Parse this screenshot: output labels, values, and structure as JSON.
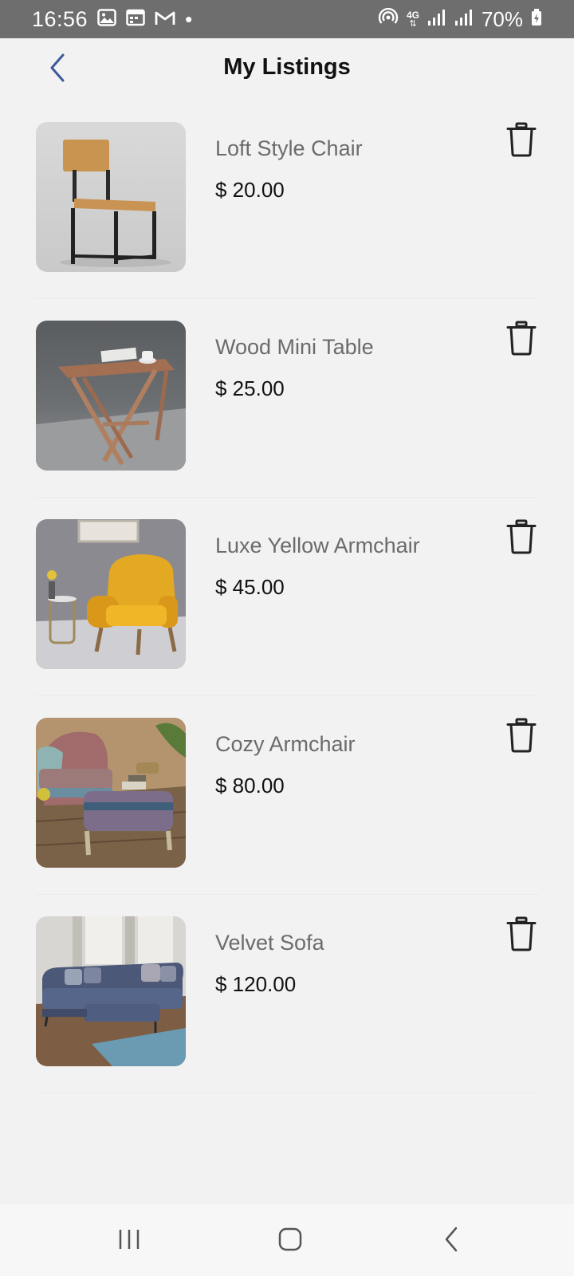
{
  "status_bar": {
    "time": "16:56",
    "battery": "70%",
    "network": "4G",
    "notification_dot": "•"
  },
  "header": {
    "title": "My Listings"
  },
  "listings": [
    {
      "name": "Loft Style Chair",
      "price": "$ 20.00"
    },
    {
      "name": "Wood Mini Table",
      "price": "$ 25.00"
    },
    {
      "name": "Luxe Yellow Armchair",
      "price": "$ 45.00"
    },
    {
      "name": "Cozy Armchair",
      "price": "$ 80.00"
    },
    {
      "name": "Velvet Sofa",
      "price": "$ 120.00"
    }
  ],
  "icons": {
    "back": "chevron-left-icon",
    "delete": "trash-icon",
    "nav_recents": "recent-apps-icon",
    "nav_home": "home-icon",
    "nav_back": "back-icon"
  },
  "colors": {
    "accent": "#3d5a99",
    "background": "#f2f2f2",
    "status_bar": "#6e6e6e",
    "text_primary": "#111111",
    "text_secondary": "#6b6b6b"
  }
}
